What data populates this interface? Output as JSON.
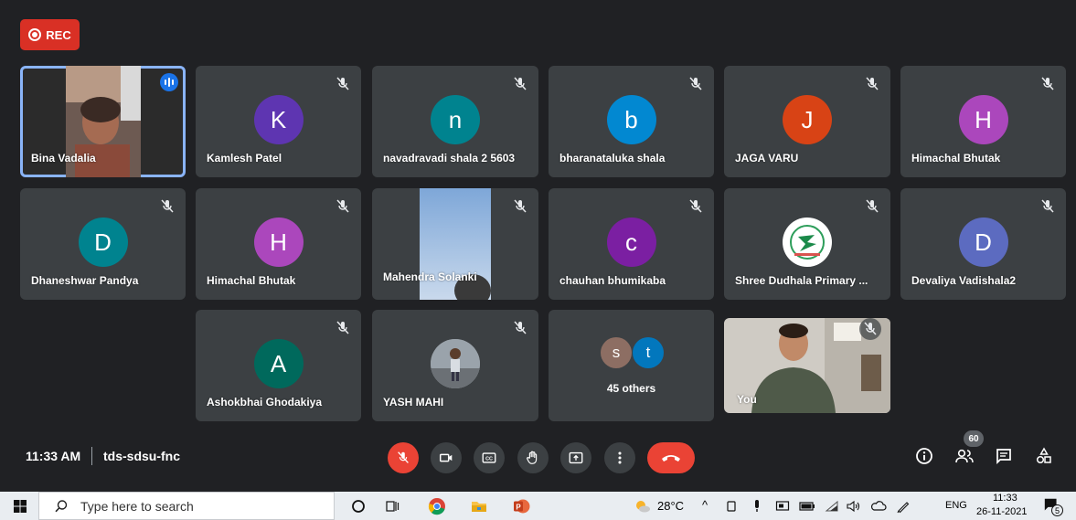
{
  "rec": {
    "label": "REC"
  },
  "tiles": [
    {
      "name": "Bina Vadalia",
      "type": "video"
    },
    {
      "name": "Kamlesh Patel",
      "initial": "K",
      "color": "#5e35b1"
    },
    {
      "name": "navadravadi shala 2 5603",
      "initial": "n",
      "color": "#00838f"
    },
    {
      "name": "bharanataluka shala",
      "initial": "b",
      "color": "#0288d1"
    },
    {
      "name": "JAGA VARU",
      "initial": "J",
      "color": "#d84315"
    },
    {
      "name": "Himachal Bhutak",
      "initial": "H",
      "color": "#ab47bc"
    },
    {
      "name": "Dhaneshwar Pandya",
      "initial": "D",
      "color": "#00838f"
    },
    {
      "name": "Himachal Bhutak",
      "initial": "H",
      "color": "#ab47bc"
    },
    {
      "name": "Mahendra Solanki",
      "type": "video"
    },
    {
      "name": "chauhan bhumikaba",
      "initial": "c",
      "color": "#7b1fa2"
    },
    {
      "name": "Shree Dudhala Primary ...",
      "type": "logo"
    },
    {
      "name": "Devaliya Vadishala2",
      "initial": "D",
      "color": "#5c6bc0"
    },
    {
      "name": "Ashokbhai Ghodakiya",
      "initial": "A",
      "color": "#00695c"
    },
    {
      "name": "YASH MAHI",
      "type": "photo"
    },
    {
      "name": "45 others",
      "type": "others",
      "initials": [
        "s",
        "t"
      ]
    },
    {
      "name": "You",
      "type": "video"
    }
  ],
  "meeting": {
    "time": "11:33 AM",
    "code": "tds-sdsu-fnc",
    "participants_count": "60"
  },
  "taskbar": {
    "search_placeholder": "Type here to search",
    "weather": "28°C",
    "language": "ENG",
    "clock_time": "11:33",
    "clock_date": "26-11-2021",
    "notification_count": "5"
  }
}
